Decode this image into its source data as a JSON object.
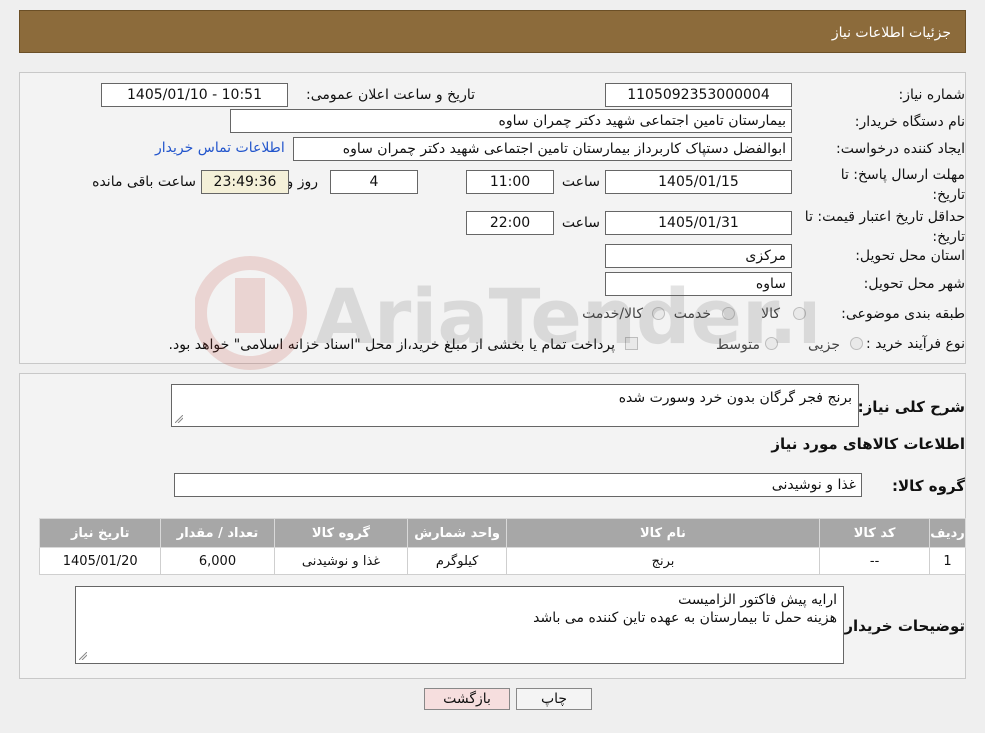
{
  "header": {
    "title": "جزئیات اطلاعات نیاز"
  },
  "form": {
    "need_number_label": "شماره نیاز:",
    "need_number": "1105092353000004",
    "announce_label": "تاریخ و ساعت اعلان عمومی:",
    "announce_value": "1405/01/10 - 10:51",
    "buyer_org_label": "نام دستگاه خریدار:",
    "buyer_org": "بیمارستان تامین اجتماعی شهید دکتر چمران ساوه",
    "creator_label": "ایجاد کننده درخواست:",
    "creator": "ابوالفضل  دستپاک  کاربرداز بیمارستان تامین اجتماعی شهید دکتر چمران ساوه",
    "contact_link": "اطلاعات تماس خریدار",
    "deadline_label": "مهلت ارسال پاسخ: تا تاریخ:",
    "deadline_date": "1405/01/15",
    "time_label": "ساعت",
    "deadline_time": "11:00",
    "remaining_days": "4",
    "days_and_label": "روز و",
    "remaining_time": "23:49:36",
    "remaining_label": "ساعت باقی مانده",
    "validity_label": "حداقل تاریخ اعتبار قیمت: تا تاریخ:",
    "validity_date": "1405/01/31",
    "validity_time": "22:00",
    "province_label": "استان محل تحویل:",
    "province": "مرکزی",
    "city_label": "شهر محل تحویل:",
    "city": "ساوه",
    "category_label": "طبقه بندی موضوعی:",
    "category_options": [
      "کالا",
      "خدمت",
      "کالا/خدمت"
    ],
    "process_label": "نوع فرآیند خرید :",
    "process_options": [
      "جزیی",
      "متوسط"
    ],
    "payment_note": "پرداخت تمام یا بخشی از مبلغ خرید،از محل \"اسناد خزانه اسلامی\" خواهد بود."
  },
  "details": {
    "description_label": "شرح کلی نیاز:",
    "description": "برنج فجر گرگان بدون خرد وسورت شده",
    "goods_info_title": "اطلاعات کالاهای مورد نیاز",
    "goods_group_label": "گروه کالا:",
    "goods_group": "غذا و نوشیدنی",
    "table": {
      "headers": [
        "ردیف",
        "کد کالا",
        "نام کالا",
        "واحد شمارش",
        "گروه کالا",
        "تعداد / مقدار",
        "تاریخ نیاز"
      ],
      "rows": [
        [
          "1",
          "--",
          "برنج",
          "کیلوگرم",
          "غذا و نوشیدنی",
          "6,000",
          "1405/01/20"
        ]
      ]
    },
    "buyer_notes_label": "توضیحات خریدار:",
    "buyer_notes_line1": "ارایه پیش فاکتور الزامیست",
    "buyer_notes_line2": "هزینه حمل تا بیمارستان به عهده تاین کننده می باشد"
  },
  "buttons": {
    "print": "چاپ",
    "back": "بازگشت"
  },
  "watermark": {
    "text": "AriaTender.neT"
  },
  "colors": {
    "header_bg": "#8c6b3b",
    "link": "#2255cc",
    "table_header": "#a7a7a7",
    "back_button": "#f6dede"
  }
}
